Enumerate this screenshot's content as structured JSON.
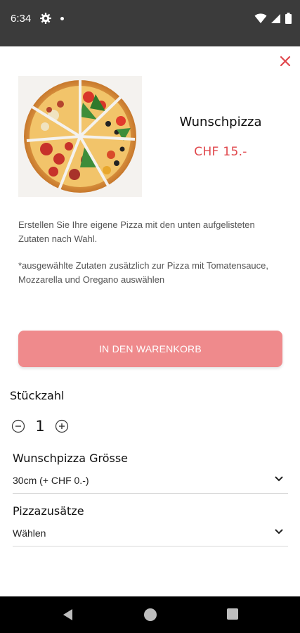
{
  "status_bar": {
    "time": "6:34",
    "icons": [
      "gear-icon",
      "notification-dot-icon",
      "wifi-icon",
      "signal-icon",
      "battery-icon"
    ]
  },
  "product": {
    "name": "Wunschpizza",
    "price": "CHF 15.-",
    "description": "Erstellen Sie Ihre eigene Pizza mit den unten aufgelisteten Zutaten nach Wahl.",
    "note": "*ausgewählte Zutaten zusätzlich zur Pizza mit Tomatensauce, Mozzarella und Oregano auswählen"
  },
  "actions": {
    "add_to_cart": "IN DEN WARENKORB"
  },
  "quantity": {
    "label": "Stückzahl",
    "value": "1"
  },
  "options": {
    "size": {
      "label": "Wunschpizza Grösse",
      "value": "30cm (+ CHF 0.-)"
    },
    "extras": {
      "label": "Pizzazusätze",
      "value": "Wählen"
    }
  },
  "colors": {
    "accent": "#e0474c",
    "button": "#ef8a8c",
    "status_bar": "#3b3b3b",
    "nav_bar": "#000000"
  }
}
